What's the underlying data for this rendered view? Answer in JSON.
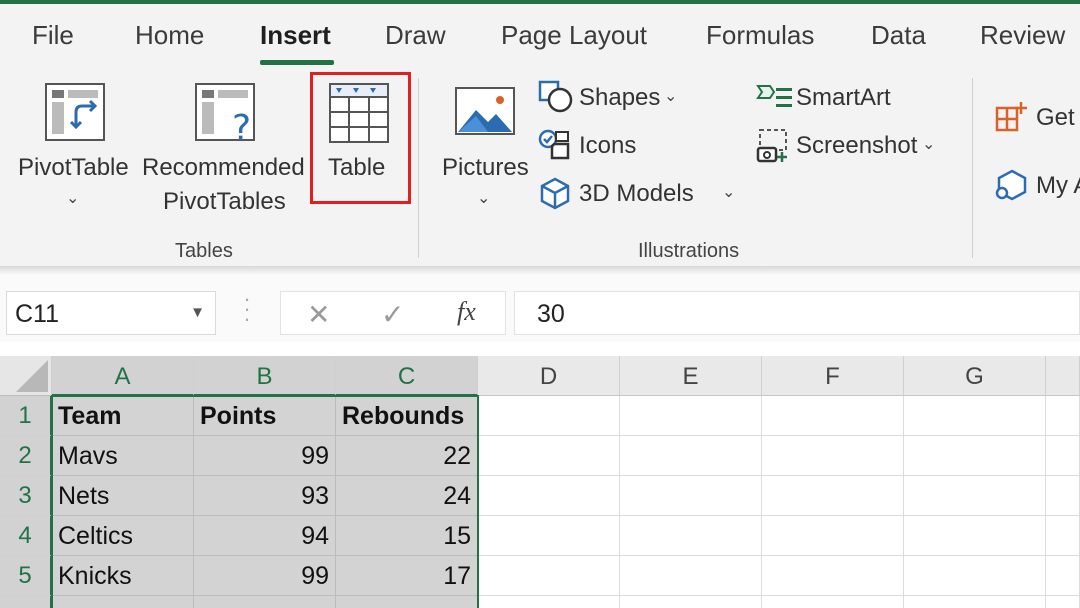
{
  "tabs": [
    "File",
    "Home",
    "Insert",
    "Draw",
    "Page Layout",
    "Formulas",
    "Data",
    "Review"
  ],
  "active_tab": "Insert",
  "ribbon": {
    "pivot_table": "PivotTable",
    "recommended_line1": "Recommended",
    "recommended_line2": "PivotTables",
    "table": "Table",
    "tables_group": "Tables",
    "pictures": "Pictures",
    "shapes": "Shapes",
    "icons": "Icons",
    "models_3d": "3D Models",
    "smartart": "SmartArt",
    "screenshot": "Screenshot",
    "illustrations_group": "Illustrations",
    "get_addins": "Get",
    "my_addins": "My A"
  },
  "formula_bar": {
    "name_box": "C11",
    "cancel_glyph": "✕",
    "enter_glyph": "✓",
    "fx": "fx",
    "value": "30"
  },
  "columns": [
    "A",
    "B",
    "C",
    "D",
    "E",
    "F",
    "G"
  ],
  "rows": [
    {
      "num": "1",
      "cells": [
        "Team",
        "Points",
        "Rebounds"
      ]
    },
    {
      "num": "2",
      "cells": [
        "Mavs",
        "99",
        "22"
      ]
    },
    {
      "num": "3",
      "cells": [
        "Nets",
        "93",
        "24"
      ]
    },
    {
      "num": "4",
      "cells": [
        "Celtics",
        "94",
        "15"
      ]
    },
    {
      "num": "5",
      "cells": [
        "Knicks",
        "99",
        "17"
      ]
    }
  ],
  "colors": {
    "accent": "#217346",
    "highlight": "#e02020",
    "icon_blue": "#2b6cb0",
    "icon_orange": "#d9622b"
  }
}
